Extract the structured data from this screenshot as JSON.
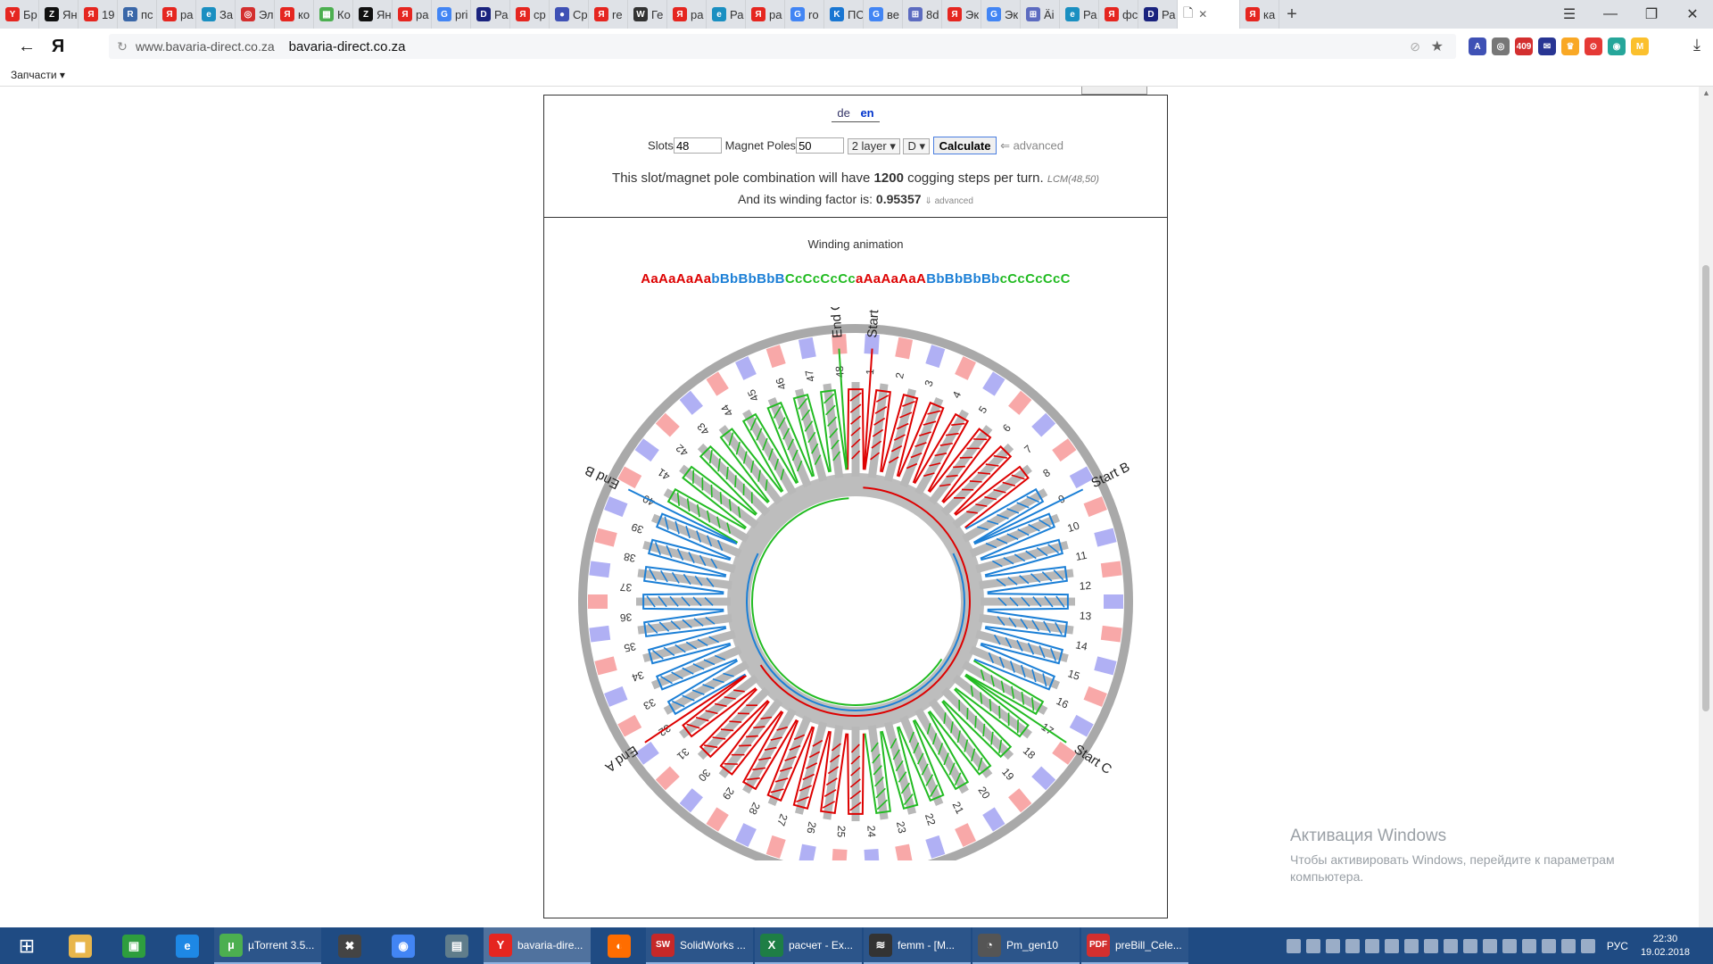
{
  "browser": {
    "tabs": [
      {
        "label": "Бр",
        "color": "#e52620",
        "glyph": "Y"
      },
      {
        "label": "Ян",
        "color": "#111111",
        "glyph": "Z"
      },
      {
        "label": "19",
        "color": "#e52620",
        "glyph": "Я"
      },
      {
        "label": "пс",
        "color": "#3a67a8",
        "glyph": "R"
      },
      {
        "label": "ра",
        "color": "#e52620",
        "glyph": "Я"
      },
      {
        "label": "За",
        "color": "#1a8fc1",
        "glyph": "e"
      },
      {
        "label": "Эл",
        "color": "#d32f2f",
        "glyph": "◎"
      },
      {
        "label": "ко",
        "color": "#e52620",
        "glyph": "Я"
      },
      {
        "label": "Ко",
        "color": "#4caf50",
        "glyph": "▦"
      },
      {
        "label": "Ян",
        "color": "#111111",
        "glyph": "Z"
      },
      {
        "label": "ра",
        "color": "#e52620",
        "glyph": "Я"
      },
      {
        "label": "pri",
        "color": "#4285f4",
        "glyph": "G"
      },
      {
        "label": "Ра",
        "color": "#1a237e",
        "glyph": "D"
      },
      {
        "label": "ср",
        "color": "#e52620",
        "glyph": "Я"
      },
      {
        "label": "Ср",
        "color": "#3f51b5",
        "glyph": "●"
      },
      {
        "label": "re",
        "color": "#e52620",
        "glyph": "Я"
      },
      {
        "label": "Ге",
        "color": "#333333",
        "glyph": "W"
      },
      {
        "label": "ра",
        "color": "#e52620",
        "glyph": "Я"
      },
      {
        "label": "Ра",
        "color": "#1a8fc1",
        "glyph": "e"
      },
      {
        "label": "ра",
        "color": "#e52620",
        "glyph": "Я"
      },
      {
        "label": "ro",
        "color": "#4285f4",
        "glyph": "G"
      },
      {
        "label": "ПС",
        "color": "#1976d2",
        "glyph": "K"
      },
      {
        "label": "ве",
        "color": "#4285f4",
        "glyph": "G"
      },
      {
        "label": "8d",
        "color": "#5c6bc0",
        "glyph": "⊞"
      },
      {
        "label": "Эк",
        "color": "#e52620",
        "glyph": "Я"
      },
      {
        "label": "Эк",
        "color": "#4285f4",
        "glyph": "G"
      },
      {
        "label": "Äi",
        "color": "#5c6bc0",
        "glyph": "⊞"
      },
      {
        "label": "Ра",
        "color": "#1a8fc1",
        "glyph": "e"
      },
      {
        "label": "фс",
        "color": "#e52620",
        "glyph": "Я"
      },
      {
        "label": "Ра",
        "color": "#1a237e",
        "glyph": "D"
      }
    ],
    "active_tab": {
      "label": "",
      "close": "✕"
    },
    "last_tab": {
      "label": "ка",
      "color": "#e52620",
      "glyph": "Я"
    },
    "new_tab": "+",
    "window_controls": {
      "menu": "☰",
      "minimize": "—",
      "restore": "❐",
      "close": "✕"
    },
    "back": "←",
    "logo": "Я",
    "url_host": "www.bavaria-direct.co.za",
    "url_title": "bavaria-direct.co.za",
    "bookmarks_label": "Запчасти ▾",
    "extensions": [
      {
        "glyph": "A",
        "color": "#3f51b5"
      },
      {
        "glyph": "◎",
        "color": "#777777"
      },
      {
        "glyph": "409",
        "color": "#d32f2f"
      },
      {
        "glyph": "✉",
        "color": "#283593"
      },
      {
        "glyph": "♛",
        "color": "#f9a825"
      },
      {
        "glyph": "⊙",
        "color": "#e53935"
      },
      {
        "glyph": "◉",
        "color": "#26a69a"
      },
      {
        "glyph": "M",
        "color": "#fbc02d"
      }
    ],
    "download_icon": "⤓"
  },
  "calculator": {
    "lang": {
      "de": "de",
      "en": "en"
    },
    "slots_label": "Slots",
    "slots_value": "48",
    "poles_label": "Magnet Poles",
    "poles_value": "50",
    "layer_select": "2 layer ▾",
    "conn_select": "D ▾",
    "calc_button": "Calculate",
    "advanced_link": "⇐ advanced",
    "cogging_pre": "This slot/magnet pole combination will have",
    "cogging_value": "1200",
    "cogging_post": "cogging steps per turn.",
    "lcm": "LCM(48,50)",
    "wf_pre": "And its winding factor is:",
    "wf_value": "0.95357",
    "wf_link": "⇓ advanced"
  },
  "winding": {
    "title": "Winding animation",
    "pattern": "AaAaAaAabBbBbBbBCcCcCcCcaAaAaAaABbBbBbBbcCcCcCcC",
    "phase_colors": {
      "A": "#dd0000",
      "B": "#1b7fd6",
      "C": "#22bb22"
    },
    "labels": {
      "start_a": "Start A",
      "end_a": "End A",
      "start_b": "Start B",
      "end_b": "End B",
      "start_c": "Start C",
      "end_c": "End C"
    },
    "slot_count": 48,
    "pole_count": 50,
    "magnet_colors": {
      "north": "#f8a8a8",
      "south": "#b0b0f4"
    }
  },
  "watermark": {
    "title": "Активация Windows",
    "line": "Чтобы активировать Windows, перейдите к параметрам компьютера."
  },
  "taskbar": {
    "start_icon": "⊞",
    "pinned": [
      {
        "name": "file-explorer",
        "glyph": "▆",
        "color": "#e8b64c"
      },
      {
        "name": "store",
        "glyph": "▣",
        "color": "#2e9e3e"
      },
      {
        "name": "ie",
        "glyph": "e",
        "color": "#1e88e5"
      }
    ],
    "apps": [
      {
        "label": "µTorrent 3.5...",
        "glyph": "µ",
        "color": "#4caf50",
        "active": false
      },
      {
        "label": "",
        "glyph": "✖",
        "color": "#444",
        "active": false,
        "pin": true
      },
      {
        "label": "",
        "glyph": "◉",
        "color": "#4285f4",
        "active": false,
        "pin": true
      },
      {
        "label": "",
        "glyph": "▤",
        "color": "#607d8b",
        "active": false,
        "pin": true
      },
      {
        "label": "bavaria-dire...",
        "glyph": "Y",
        "color": "#e52620",
        "active": true
      },
      {
        "label": "",
        "glyph": "◐",
        "color": "#ff6d00",
        "active": false,
        "pin": true
      },
      {
        "label": "SolidWorks ...",
        "glyph": "SW",
        "color": "#c62828",
        "active": false
      },
      {
        "label": "расчет - Ex...",
        "glyph": "X",
        "color": "#1e7e45",
        "active": false
      },
      {
        "label": "femm - [M...",
        "glyph": "≋",
        "color": "#333",
        "active": false
      },
      {
        "label": "Pm_gen10",
        "glyph": "◔",
        "color": "#555",
        "active": false
      },
      {
        "label": "preBill_Cele...",
        "glyph": "PDF",
        "color": "#d32f2f",
        "active": false
      }
    ],
    "tray_lang": "РУС",
    "time": "22:30",
    "date": "19.02.2018"
  }
}
